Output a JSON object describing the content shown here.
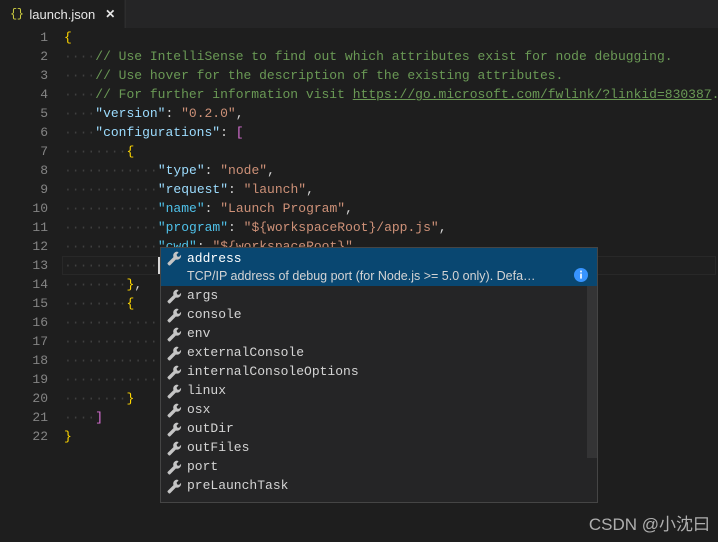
{
  "window": {
    "background": "#1e1e1e",
    "tabbar_background": "#252526"
  },
  "tab": {
    "icon": "json-braces-icon",
    "icon_glyph": "{}",
    "label": "launch.json",
    "close_glyph": "✕"
  },
  "editor": {
    "language": "json",
    "total_lines": 22,
    "cursor": {
      "line": 13,
      "column": 13
    },
    "lines": [
      {
        "num": "1",
        "indent": 0,
        "tokens": [
          {
            "t": "brace",
            "v": "{"
          }
        ]
      },
      {
        "num": "2",
        "indent": 1,
        "tokens": [
          {
            "t": "comment",
            "v": "// Use IntelliSense to find out which attributes exist for node debugging."
          }
        ]
      },
      {
        "num": "3",
        "indent": 1,
        "tokens": [
          {
            "t": "comment",
            "v": "// Use hover for the description of the existing attributes."
          }
        ]
      },
      {
        "num": "4",
        "indent": 1,
        "tokens": [
          {
            "t": "comment",
            "v": "// For further information visit "
          },
          {
            "t": "link",
            "v": "https://go.microsoft.com/fwlink/?linkid=830387"
          },
          {
            "t": "comment",
            "v": "."
          }
        ]
      },
      {
        "num": "5",
        "indent": 1,
        "tokens": [
          {
            "t": "key",
            "v": "\"version\""
          },
          {
            "t": "punc",
            "v": ": "
          },
          {
            "t": "str",
            "v": "\"0.2.0\""
          },
          {
            "t": "punc",
            "v": ","
          }
        ]
      },
      {
        "num": "6",
        "indent": 1,
        "tokens": [
          {
            "t": "key",
            "v": "\"configurations\""
          },
          {
            "t": "punc",
            "v": ": "
          },
          {
            "t": "brack",
            "v": "["
          }
        ]
      },
      {
        "num": "7",
        "indent": 2,
        "tokens": [
          {
            "t": "brace",
            "v": "{"
          }
        ]
      },
      {
        "num": "8",
        "indent": 3,
        "tokens": [
          {
            "t": "key",
            "v": "\"type\""
          },
          {
            "t": "punc",
            "v": ": "
          },
          {
            "t": "str",
            "v": "\"node\""
          },
          {
            "t": "punc",
            "v": ","
          }
        ]
      },
      {
        "num": "9",
        "indent": 3,
        "tokens": [
          {
            "t": "key",
            "v": "\"request\""
          },
          {
            "t": "punc",
            "v": ": "
          },
          {
            "t": "str",
            "v": "\"launch\""
          },
          {
            "t": "punc",
            "v": ","
          }
        ]
      },
      {
        "num": "10",
        "indent": 3,
        "tokens": [
          {
            "t": "keyhl",
            "v": "\"name\""
          },
          {
            "t": "punc",
            "v": ": "
          },
          {
            "t": "str",
            "v": "\"Launch Program\""
          },
          {
            "t": "punc",
            "v": ","
          }
        ]
      },
      {
        "num": "11",
        "indent": 3,
        "tokens": [
          {
            "t": "keyhl",
            "v": "\"program\""
          },
          {
            "t": "punc",
            "v": ": "
          },
          {
            "t": "str",
            "v": "\"${workspaceRoot}/app.js\""
          },
          {
            "t": "punc",
            "v": ","
          }
        ]
      },
      {
        "num": "12",
        "indent": 3,
        "tokens": [
          {
            "t": "keyhl",
            "v": "\"cwd\""
          },
          {
            "t": "punc",
            "v": ": "
          },
          {
            "t": "str",
            "v": "\"${workspaceRoot}\""
          }
        ]
      },
      {
        "num": "13",
        "indent": 3,
        "tokens": [],
        "current": true
      },
      {
        "num": "14",
        "indent": 2,
        "tokens": [
          {
            "t": "brace",
            "v": "}"
          },
          {
            "t": "punc",
            "v": ","
          }
        ]
      },
      {
        "num": "15",
        "indent": 2,
        "tokens": [
          {
            "t": "brace",
            "v": "{"
          }
        ]
      },
      {
        "num": "16",
        "indent": 3,
        "tokens": []
      },
      {
        "num": "17",
        "indent": 3,
        "tokens": []
      },
      {
        "num": "18",
        "indent": 3,
        "tokens": []
      },
      {
        "num": "19",
        "indent": 3,
        "tokens": []
      },
      {
        "num": "20",
        "indent": 2,
        "tokens": [
          {
            "t": "brace",
            "v": "}"
          }
        ]
      },
      {
        "num": "21",
        "indent": 1,
        "tokens": [
          {
            "t": "brack",
            "v": "]"
          }
        ]
      },
      {
        "num": "22",
        "indent": 0,
        "tokens": [
          {
            "t": "brace",
            "v": "}"
          }
        ]
      }
    ]
  },
  "suggest": {
    "visible": true,
    "selected_index": 0,
    "selected_color": "#094771",
    "info_icon": "info-icon",
    "items": [
      {
        "icon": "property-wrench-icon",
        "label": "address",
        "detail": "TCP/IP address of debug port (for Node.js >= 5.0 only). Defa…"
      },
      {
        "icon": "property-wrench-icon",
        "label": "args",
        "detail": ""
      },
      {
        "icon": "property-wrench-icon",
        "label": "console",
        "detail": ""
      },
      {
        "icon": "property-wrench-icon",
        "label": "env",
        "detail": ""
      },
      {
        "icon": "property-wrench-icon",
        "label": "externalConsole",
        "detail": ""
      },
      {
        "icon": "property-wrench-icon",
        "label": "internalConsoleOptions",
        "detail": ""
      },
      {
        "icon": "property-wrench-icon",
        "label": "linux",
        "detail": ""
      },
      {
        "icon": "property-wrench-icon",
        "label": "osx",
        "detail": ""
      },
      {
        "icon": "property-wrench-icon",
        "label": "outDir",
        "detail": ""
      },
      {
        "icon": "property-wrench-icon",
        "label": "outFiles",
        "detail": ""
      },
      {
        "icon": "property-wrench-icon",
        "label": "port",
        "detail": ""
      },
      {
        "icon": "property-wrench-icon",
        "label": "preLaunchTask",
        "detail": ""
      }
    ]
  },
  "watermark": {
    "text": "CSDN @小沈曰"
  }
}
